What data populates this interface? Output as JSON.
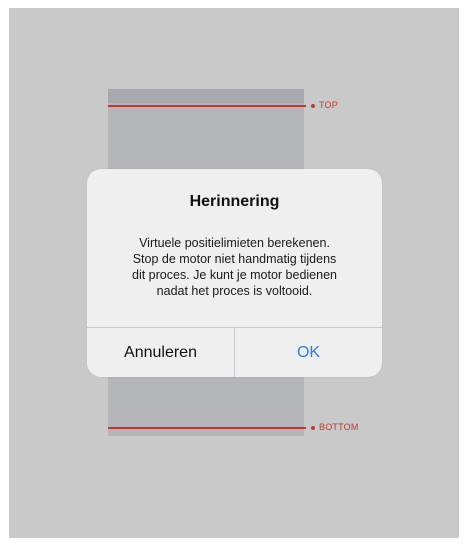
{
  "window": {
    "top_limit_label": "TOP",
    "bottom_limit_label": "BOTTOM",
    "limit_color": "#c0392b"
  },
  "alert": {
    "title": "Herinnering",
    "message_lines": [
      "Virtuele positielimieten berekenen.",
      "Stop de motor niet handmatig tijdens",
      "dit proces. Je kunt je motor bedienen",
      "nadat het proces is voltooid."
    ],
    "cancel_label": "Annuleren",
    "ok_label": "OK",
    "ok_color": "#2b7de9"
  }
}
